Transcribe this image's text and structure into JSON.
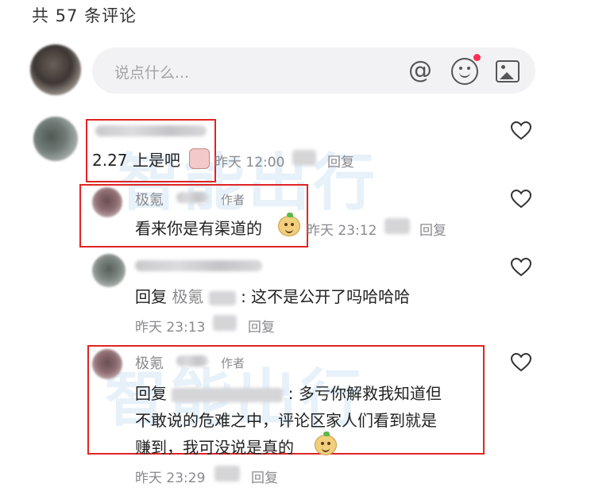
{
  "header": {
    "comment_count_title": "共 57 条评论"
  },
  "composer": {
    "placeholder": "说点什么...",
    "icons": [
      "at-icon",
      "emoji-icon",
      "image-icon"
    ],
    "has_notification_dot": true
  },
  "comments": [
    {
      "text": "2.27 上是吧",
      "time": "昨天 12:00",
      "reply_label": "回复",
      "highlighted": true
    },
    {
      "author": "极氪",
      "author_tag": "作者",
      "text": "看来你是有渠道的",
      "time": "昨天 23:12",
      "reply_label": "回复",
      "highlighted": true
    },
    {
      "reply_prefix": "回复",
      "reply_to": "极氪",
      "text": ": 这不是公开了吗哈哈哈",
      "time": "昨天 23:13",
      "reply_label": "回复",
      "highlighted": false
    },
    {
      "author": "极氪",
      "author_tag": "作者",
      "reply_prefix": "回复",
      "text_line1": ": 多亏你解救我知道但",
      "text_line2": "不敢说的危难之中，评论区家人们看到就是",
      "text_line3": "赚到，我可没说是真的",
      "time": "昨天 23:29",
      "reply_label": "回复",
      "highlighted": true
    }
  ],
  "colors": {
    "highlight_border": "#e02424",
    "notification_dot": "#ff2d55",
    "meta_text": "#8a8a8f"
  }
}
